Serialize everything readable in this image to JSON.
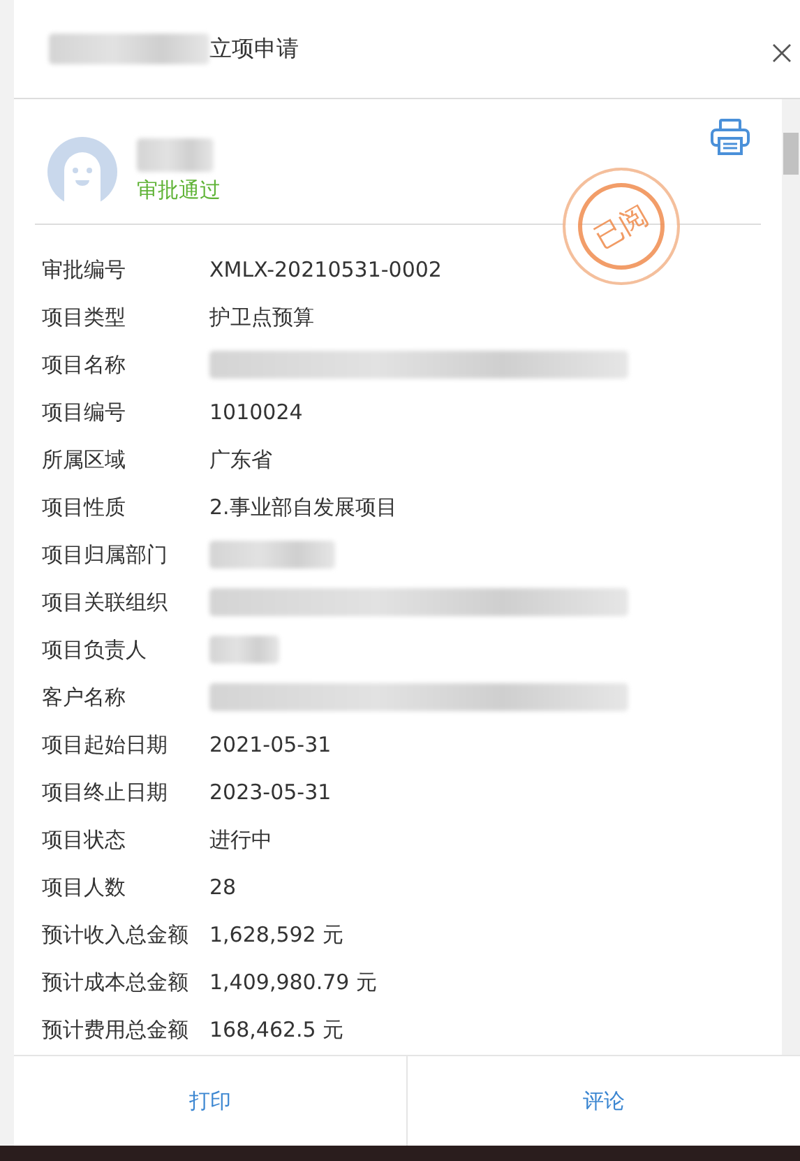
{
  "dialog": {
    "title": "立项申请",
    "title_redacted": true
  },
  "applicant": {
    "name_redacted": true,
    "status": "审批通过"
  },
  "stamp": {
    "text": "已阅"
  },
  "fields": [
    {
      "label": "审批编号",
      "kind": "text",
      "value": "XMLX-20210531-0002"
    },
    {
      "label": "项目类型",
      "kind": "text",
      "value": "护卫点预算"
    },
    {
      "label": "项目名称",
      "kind": "redacted"
    },
    {
      "label": "项目编号",
      "kind": "text",
      "value": "1010024"
    },
    {
      "label": "所属区域",
      "kind": "text",
      "value": "广东省"
    },
    {
      "label": "项目性质",
      "kind": "text",
      "value": "2.事业部自发展项目"
    },
    {
      "label": "项目归属部门",
      "kind": "redacted"
    },
    {
      "label": "项目关联组织",
      "kind": "redacted"
    },
    {
      "label": "项目负责人",
      "kind": "redacted"
    },
    {
      "label": "客户名称",
      "kind": "redacted"
    },
    {
      "label": "项目起始日期",
      "kind": "text",
      "value": "2021-05-31"
    },
    {
      "label": "项目终止日期",
      "kind": "text",
      "value": "2023-05-31"
    },
    {
      "label": "项目状态",
      "kind": "text",
      "value": "进行中"
    },
    {
      "label": "项目人数",
      "kind": "text",
      "value": "28"
    },
    {
      "label": "预计收入总金额",
      "kind": "text",
      "value": "1,628,592 元"
    },
    {
      "label": "预计成本总金额",
      "kind": "text",
      "value": "1,409,980.79 元"
    },
    {
      "label": "预计费用总金额",
      "kind": "text",
      "value": "168,462.5 元"
    }
  ],
  "buttons": [
    "打印",
    "评论"
  ]
}
